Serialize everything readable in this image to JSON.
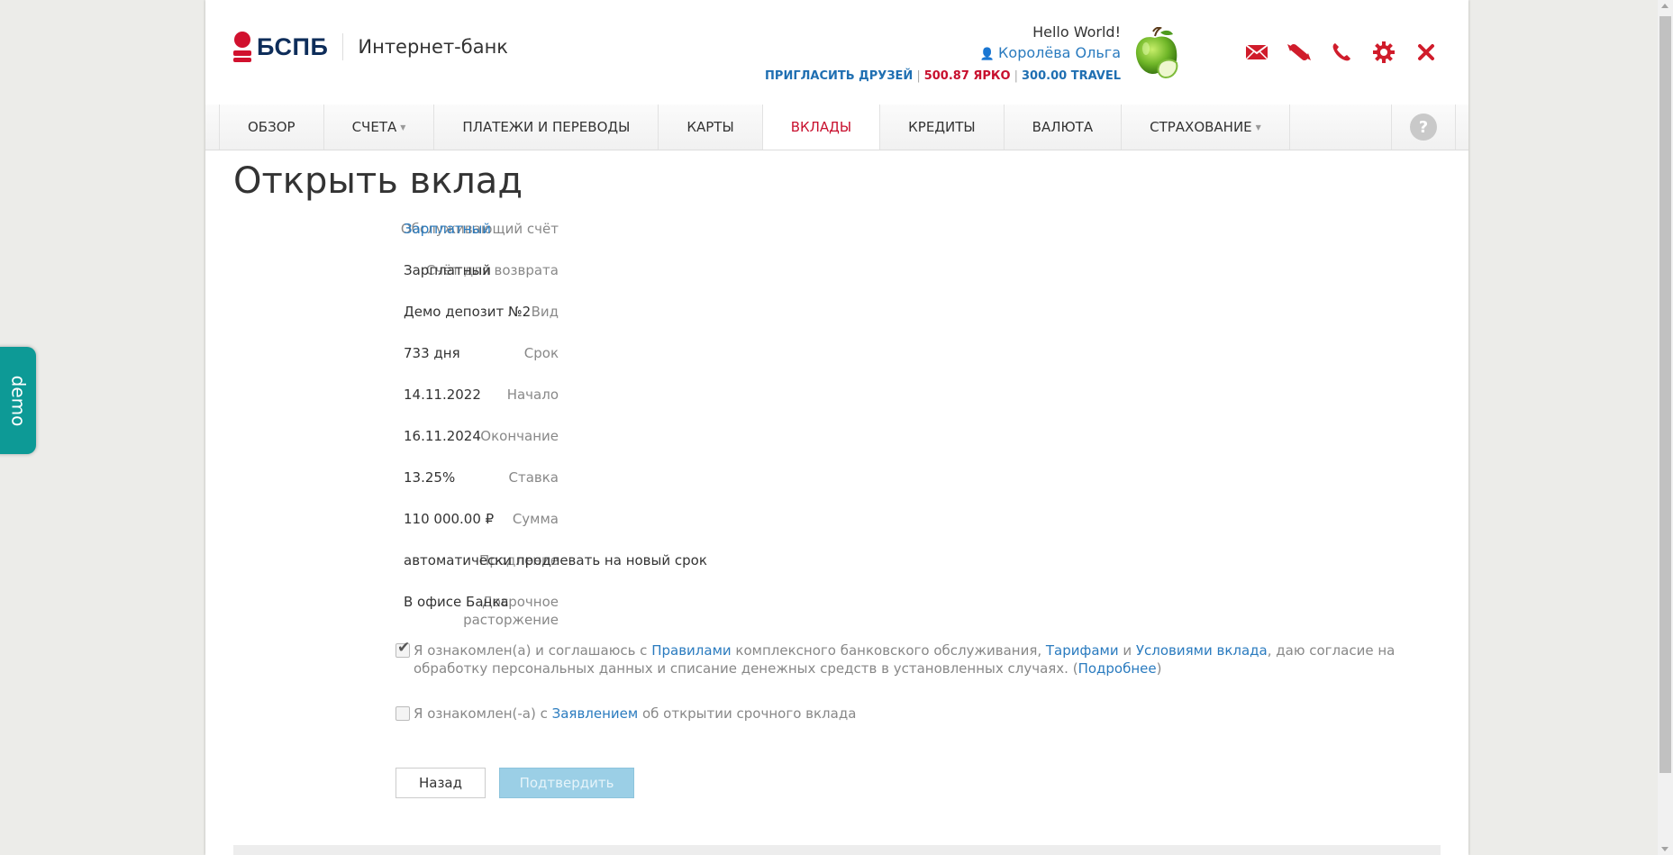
{
  "header": {
    "logo_text": "БСПБ",
    "logo_subtitle": "Интернет-банк",
    "greeting": "Hello World!",
    "user_name": "Королёва Ольга",
    "bonus": {
      "invite": "ПРИГЛАСИТЬ ДРУЗЕЙ",
      "yarko": "500.87 ЯРКО",
      "travel": "300.00 TRAVEL"
    },
    "icons": [
      "mail-icon",
      "candy-icon",
      "phone-icon",
      "settings-gear-icon",
      "close-icon"
    ]
  },
  "nav": {
    "items": [
      {
        "label": "ОБЗОР",
        "has_menu": false
      },
      {
        "label": "СЧЕТА",
        "has_menu": true
      },
      {
        "label": "ПЛАТЕЖИ И ПЕРЕВОДЫ",
        "has_menu": false
      },
      {
        "label": "КАРТЫ",
        "has_menu": false
      },
      {
        "label": "ВКЛАДЫ",
        "has_menu": false,
        "active": true
      },
      {
        "label": "КРЕДИТЫ",
        "has_menu": false
      },
      {
        "label": "ВАЛЮТА",
        "has_menu": false
      },
      {
        "label": "СТРАХОВАНИЕ",
        "has_menu": true
      }
    ],
    "help": "?"
  },
  "page": {
    "title": "Открыть вклад",
    "fields": [
      {
        "label": "Обслуживающий счёт",
        "value": "Зарплатный"
      },
      {
        "label": "Счёт для возврата",
        "value": "Зарплатный"
      },
      {
        "label": "Вид",
        "value": "Демо депозит №2"
      },
      {
        "label": "Срок",
        "value": "733 дня"
      },
      {
        "label": "Начало",
        "value": "14.11.2022"
      },
      {
        "label": "Окончание",
        "value": "16.11.2024"
      },
      {
        "label": "Ставка",
        "value": "13.25%"
      },
      {
        "label": "Сумма",
        "value": "110 000.00 ₽"
      },
      {
        "label": "Продление",
        "value": "автоматически продлевать на новый срок"
      },
      {
        "label_line1": "Досрочное",
        "label_line2": "расторжение",
        "value": "В офисе Банка"
      }
    ],
    "agreement1": {
      "checked": true,
      "t1": "Я ознакомлен(а) и соглашаюсь с ",
      "link1": "Правилами",
      "t2": " комплексного банковского обслуживания, ",
      "link2": "Тарифами",
      "t3": " и ",
      "link3": "Условиями вклада",
      "t4": ", даю согласие на обработку персональных данных и списание денежных средств в установленных случаях. (",
      "link4": "Подробнее",
      "t5": ")"
    },
    "agreement2": {
      "checked": false,
      "t1": "Я ознакомлен(-а) с ",
      "link1": "Заявлением",
      "t2": " об открытии срочного вклада"
    },
    "buttons": {
      "back": "Назад",
      "confirm": "Подтвердить"
    }
  },
  "demo_tab": "demo",
  "colors": {
    "brand_red": "#c8102e",
    "link_blue": "#2a7bbf",
    "demo_teal": "#0d9a96"
  }
}
